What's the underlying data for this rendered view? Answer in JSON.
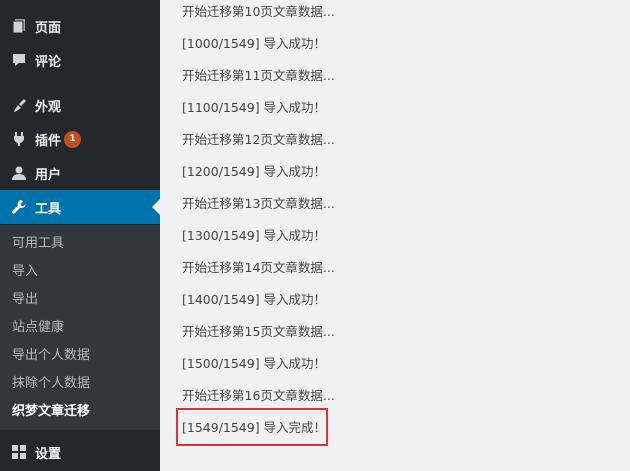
{
  "sidebar": {
    "items": [
      {
        "name": "pages",
        "label": "页面",
        "icon": "page-icon"
      },
      {
        "name": "comments",
        "label": "评论",
        "icon": "comment-icon"
      },
      {
        "name": "appearance",
        "label": "外观",
        "icon": "brush-icon"
      },
      {
        "name": "plugins",
        "label": "插件",
        "icon": "plugin-icon",
        "badge": "1"
      },
      {
        "name": "users",
        "label": "用户",
        "icon": "user-icon"
      },
      {
        "name": "tools",
        "label": "工具",
        "icon": "wrench-icon",
        "active": true
      },
      {
        "name": "settings",
        "label": "设置",
        "icon": "settings-icon"
      }
    ],
    "submenu": [
      "可用工具",
      "导入",
      "导出",
      "站点健康",
      "导出个人数据",
      "抹除个人数据",
      "织梦文章迁移"
    ],
    "submenu_current": "织梦文章迁移"
  },
  "log": [
    "开始迁移第10页文章数据...",
    "[1000/1549] 导入成功！",
    "开始迁移第11页文章数据...",
    "[1100/1549] 导入成功！",
    "开始迁移第12页文章数据...",
    "[1200/1549] 导入成功！",
    "开始迁移第13页文章数据...",
    "[1300/1549] 导入成功！",
    "开始迁移第14页文章数据...",
    "[1400/1549] 导入成功！",
    "开始迁移第15页文章数据...",
    "[1500/1549] 导入成功！",
    "开始迁移第16页文章数据...",
    "[1549/1549] 导入完成！"
  ],
  "colors": {
    "sidebar_bg": "#23282d",
    "submenu_bg": "#32373c",
    "active_bg": "#0073aa",
    "badge": "#ca4a1f",
    "highlight_border": "#d63638"
  }
}
